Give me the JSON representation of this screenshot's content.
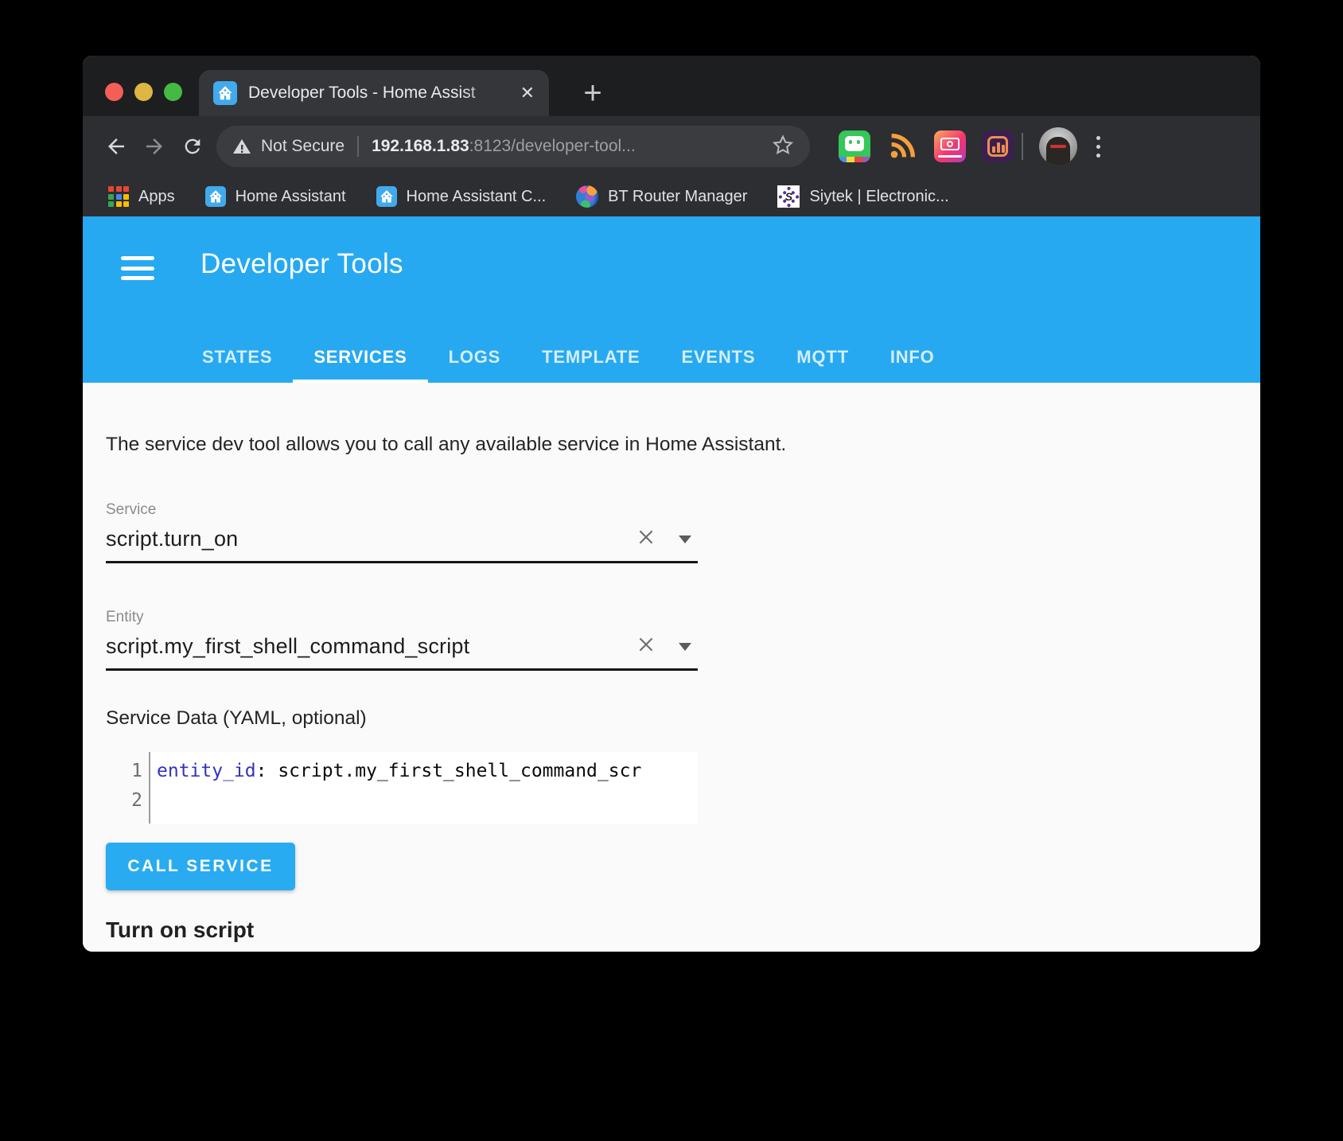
{
  "browser": {
    "tab": {
      "title": "Developer Tools - Home Assist"
    },
    "address": {
      "security": "Not Secure",
      "host": "192.168.1.83",
      "path": ":8123/developer-tool..."
    },
    "extensions": [
      "bitmoji-icon",
      "rss-feed-icon",
      "instagram-camera-icon",
      "analytics-refresh-icon"
    ],
    "bookmarks": [
      {
        "label": "Apps",
        "icon": "apps-grid-icon"
      },
      {
        "label": "Home Assistant",
        "icon": "home-assistant-icon"
      },
      {
        "label": "Home Assistant C...",
        "icon": "home-assistant-icon"
      },
      {
        "label": "BT Router Manager",
        "icon": "bt-globe-icon"
      },
      {
        "label": "Siytek | Electronic...",
        "icon": "siytek-icon"
      }
    ]
  },
  "app": {
    "title": "Developer Tools",
    "tabs": [
      {
        "label": "STATES",
        "active": false
      },
      {
        "label": "SERVICES",
        "active": true
      },
      {
        "label": "LOGS",
        "active": false
      },
      {
        "label": "TEMPLATE",
        "active": false
      },
      {
        "label": "EVENTS",
        "active": false
      },
      {
        "label": "MQTT",
        "active": false
      },
      {
        "label": "INFO",
        "active": false
      }
    ]
  },
  "content": {
    "intro": "The service dev tool allows you to call any available service in Home Assistant.",
    "service_field": {
      "label": "Service",
      "value": "script.turn_on"
    },
    "entity_field": {
      "label": "Entity",
      "value": "script.my_first_shell_command_script"
    },
    "yaml_label": "Service Data (YAML, optional)",
    "editor": {
      "gutter": [
        "1",
        "2"
      ],
      "line1_key": "entity_id",
      "line1_sep": ": ",
      "line1_value": "script.my_first_shell_command_scr"
    },
    "call_button": "CALL SERVICE",
    "result_title": "Turn on script"
  },
  "colors": {
    "header_blue": "#27a9f1",
    "button_blue": "#29abf2",
    "yaml_key": "#3432bd",
    "chrome_dark": "#2d2e31"
  }
}
